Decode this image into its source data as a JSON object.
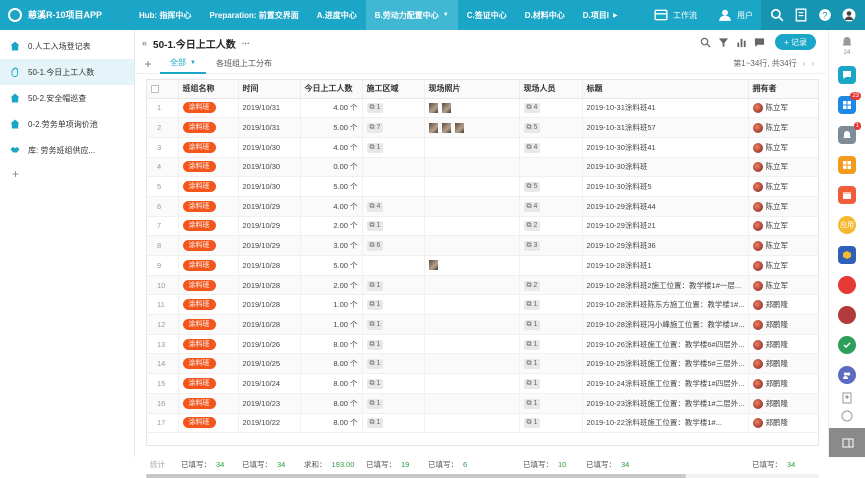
{
  "app": {
    "brand": "慈溪R-10项目APP",
    "nav_tabs": [
      {
        "label": "Hub: 指挥中心",
        "active": false
      },
      {
        "label": "Preparation: 前置交界面",
        "active": false
      },
      {
        "label": "A.进度中心",
        "active": false
      },
      {
        "label": "B.劳动力配置中心",
        "active": true
      },
      {
        "label": "C.签证中心",
        "active": false
      },
      {
        "label": "D.材料中心",
        "active": false
      },
      {
        "label": "D.项目l",
        "active": false
      }
    ],
    "right": {
      "workflow": "工作流",
      "user": "用户"
    }
  },
  "sidebar": {
    "items": [
      {
        "label": "0.人工入场登记表",
        "icon": "house-icon",
        "active": false
      },
      {
        "label": "50-1.今日上工人数",
        "icon": "hand-icon",
        "active": true
      },
      {
        "label": "50-2.安全帽巡查",
        "icon": "house-icon",
        "active": false
      },
      {
        "label": "0-2.劳务单项询价池",
        "icon": "house-icon",
        "active": false
      },
      {
        "label": "库: 劳务班组供应...",
        "icon": "handshake-icon",
        "active": false
      }
    ],
    "add": "+"
  },
  "page": {
    "back": "«",
    "title": "50-1.今日上工人数",
    "more": "···",
    "record_button": "+ 记录",
    "view_add": "+",
    "views": [
      {
        "label": "全部",
        "active": true
      },
      {
        "label": "各班组上工分布",
        "active": false
      }
    ],
    "pager": "第1~34行, 共34行",
    "pager_prev": "‹",
    "pager_next": "›"
  },
  "table": {
    "columns": [
      "班组名称",
      "时间",
      "今日上工人数",
      "施工区域",
      "现场照片",
      "现场人员",
      "标题",
      "拥有者"
    ],
    "rows": [
      {
        "idx": "1",
        "team": "涂料班",
        "date": "2019/10/31",
        "count": "4.00 个",
        "area": "1",
        "photos": 2,
        "people": "4",
        "title": "2019-10-31涂料班41",
        "owner": "陈立军"
      },
      {
        "idx": "2",
        "team": "涂料班",
        "date": "2019/10/31",
        "count": "5.00 个",
        "area": "7",
        "photos": 3,
        "people": "5",
        "title": "2019-10-31涂料班57",
        "owner": "陈立军"
      },
      {
        "idx": "3",
        "team": "涂料班",
        "date": "2019/10/30",
        "count": "4.00 个",
        "area": "1",
        "photos": 0,
        "people": "4",
        "title": "2019-10-30涂料班41",
        "owner": "陈立军"
      },
      {
        "idx": "4",
        "team": "涂料班",
        "date": "2019/10/30",
        "count": "0.00 个",
        "area": "",
        "photos": 0,
        "people": "",
        "title": "2019-10-30涂料班",
        "owner": "陈立军"
      },
      {
        "idx": "5",
        "team": "涂料班",
        "date": "2019/10/30",
        "count": "5.00 个",
        "area": "",
        "photos": 0,
        "people": "5",
        "title": "2019-10-30涂料班5",
        "owner": "陈立军"
      },
      {
        "idx": "6",
        "team": "涂料班",
        "date": "2019/10/29",
        "count": "4.00 个",
        "area": "4",
        "photos": 0,
        "people": "4",
        "title": "2019-10-29涂料班44",
        "owner": "陈立军"
      },
      {
        "idx": "7",
        "team": "涂料班",
        "date": "2019/10/29",
        "count": "2.00 个",
        "area": "1",
        "photos": 0,
        "people": "2",
        "title": "2019-10-29涂料班21",
        "owner": "陈立军"
      },
      {
        "idx": "8",
        "team": "涂料班",
        "date": "2019/10/29",
        "count": "3.00 个",
        "area": "6",
        "photos": 0,
        "people": "3",
        "title": "2019-10-29涂料班36",
        "owner": "陈立军"
      },
      {
        "idx": "9",
        "team": "涂料班",
        "date": "2019/10/28",
        "count": "5.00 个",
        "area": "",
        "photos": 1,
        "people": "",
        "title": "2019-10-28涂料班1",
        "owner": "陈立军"
      },
      {
        "idx": "10",
        "team": "涂料班",
        "date": "2019/10/28",
        "count": "2.00 个",
        "area": "1",
        "photos": 0,
        "people": "2",
        "title": "2019-10-28涂料班2施工位置：教学楼1#一层...",
        "owner": "陈立军"
      },
      {
        "idx": "11",
        "team": "涂料班",
        "date": "2019/10/28",
        "count": "1.00 个",
        "area": "1",
        "photos": 0,
        "people": "1",
        "title": "2019-10-28涂料班陈东方施工位置：教学楼1#...",
        "owner": "郑鹏隆"
      },
      {
        "idx": "12",
        "team": "涂料班",
        "date": "2019/10/28",
        "count": "1.00 个",
        "area": "1",
        "photos": 0,
        "people": "1",
        "title": "2019-10-28涂料班冯小峰施工位置：教学楼1#...",
        "owner": "郑鹏隆"
      },
      {
        "idx": "13",
        "team": "涂料班",
        "date": "2019/10/26",
        "count": "8.00 个",
        "area": "1",
        "photos": 0,
        "people": "1",
        "title": "2019-10-26涂料班施工位置：教学楼6#四层外...",
        "owner": "郑鹏隆"
      },
      {
        "idx": "14",
        "team": "涂料班",
        "date": "2019/10/25",
        "count": "8.00 个",
        "area": "1",
        "photos": 0,
        "people": "1",
        "title": "2019-10-25涂料班施工位置：教学楼5#三层外...",
        "owner": "郑鹏隆"
      },
      {
        "idx": "15",
        "team": "涂料班",
        "date": "2019/10/24",
        "count": "8.00 个",
        "area": "1",
        "photos": 0,
        "people": "1",
        "title": "2019-10-24涂料班施工位置：教学楼1#四层外...",
        "owner": "郑鹏隆"
      },
      {
        "idx": "16",
        "team": "涂料班",
        "date": "2019/10/23",
        "count": "8.00 个",
        "area": "1",
        "photos": 0,
        "people": "1",
        "title": "2019-10-23涂料班施工位置：教学楼1#二层外...",
        "owner": "郑鹏隆"
      },
      {
        "idx": "17",
        "team": "涂料班",
        "date": "2019/10/22",
        "count": "8.00 个",
        "area": "1",
        "photos": 0,
        "people": "1",
        "title": "2019-10-22涂料班施工位置：教学楼1#...",
        "owner": "郑鹏隆"
      }
    ],
    "footer": {
      "label": "统计",
      "team": {
        "label": "已填写：",
        "value": "34"
      },
      "date": {
        "label": "已填写：",
        "value": "34"
      },
      "count": {
        "label": "求和：",
        "value": "193.00"
      },
      "area": {
        "label": "已填写：",
        "value": "19"
      },
      "photos": {
        "label": "已填写：",
        "value": "6"
      },
      "people": {
        "label": "已填写：",
        "value": "10"
      },
      "title": {
        "label": "已填写：",
        "value": "34"
      },
      "owner": {
        "label": "已填写：",
        "value": "34"
      }
    }
  },
  "rightbar": {
    "count_label": "24",
    "badges": [
      "23",
      "1"
    ],
    "app_label": "应用"
  },
  "colors": {
    "primary": "#1ba5c6",
    "tag": "#f2561d",
    "stat_value": "#2b9c3f"
  }
}
